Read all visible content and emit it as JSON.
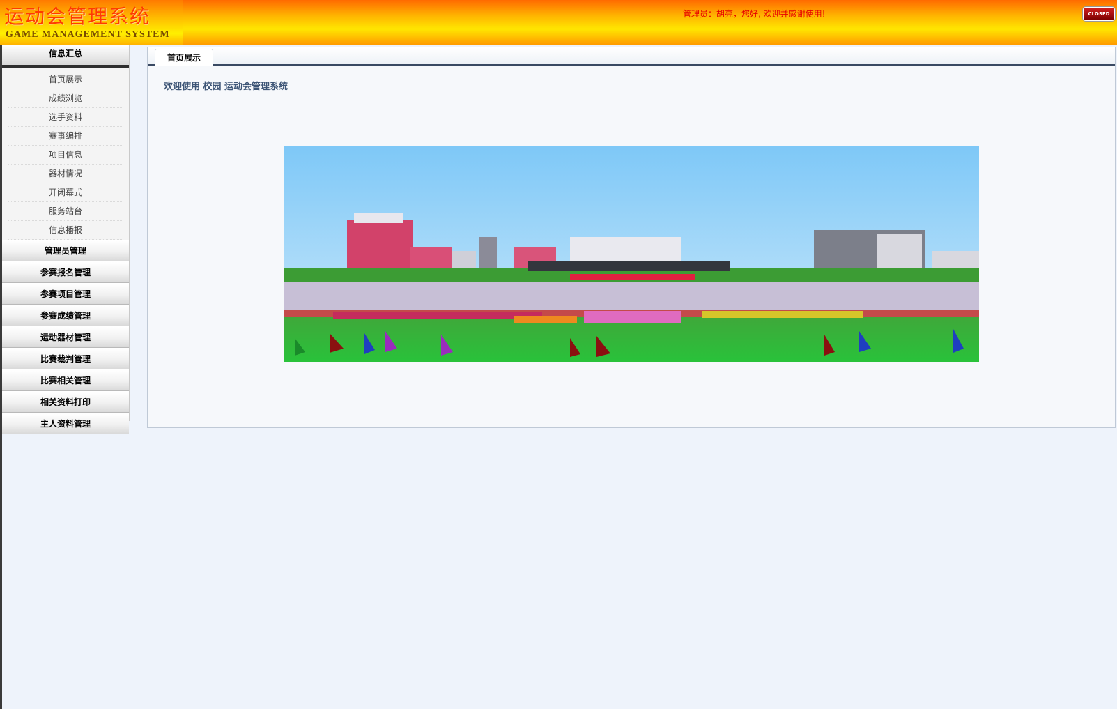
{
  "header": {
    "title": "运动会管理系统",
    "subtitle": "GAME MANAGEMENT SYSTEM",
    "welcome": "管理员：胡亮，您好, 欢迎并感谢使用!",
    "close_label": "CLOSED"
  },
  "sidebar": {
    "info_section": "信息汇总",
    "info_items": [
      "首页展示",
      "成绩浏览",
      "选手资料",
      "赛事编排",
      "项目信息",
      "器材情况",
      "开闭幕式",
      "服务站台",
      "信息播报"
    ],
    "management_sections": [
      "管理员管理",
      "参赛报名管理",
      "参赛项目管理",
      "参赛成绩管理",
      "运动器材管理",
      "比赛裁判管理",
      "比赛相关管理",
      "相关资料打印",
      "主人资料管理"
    ]
  },
  "main": {
    "tab_label": "首页展示",
    "welcome_text": "欢迎使用 校园 运动会管理系统"
  },
  "colors": {
    "header_orange": "#ff6a00",
    "header_yellow": "#ffe600",
    "welcome_red": "#e60000",
    "tab_underline": "#3a4a63"
  }
}
